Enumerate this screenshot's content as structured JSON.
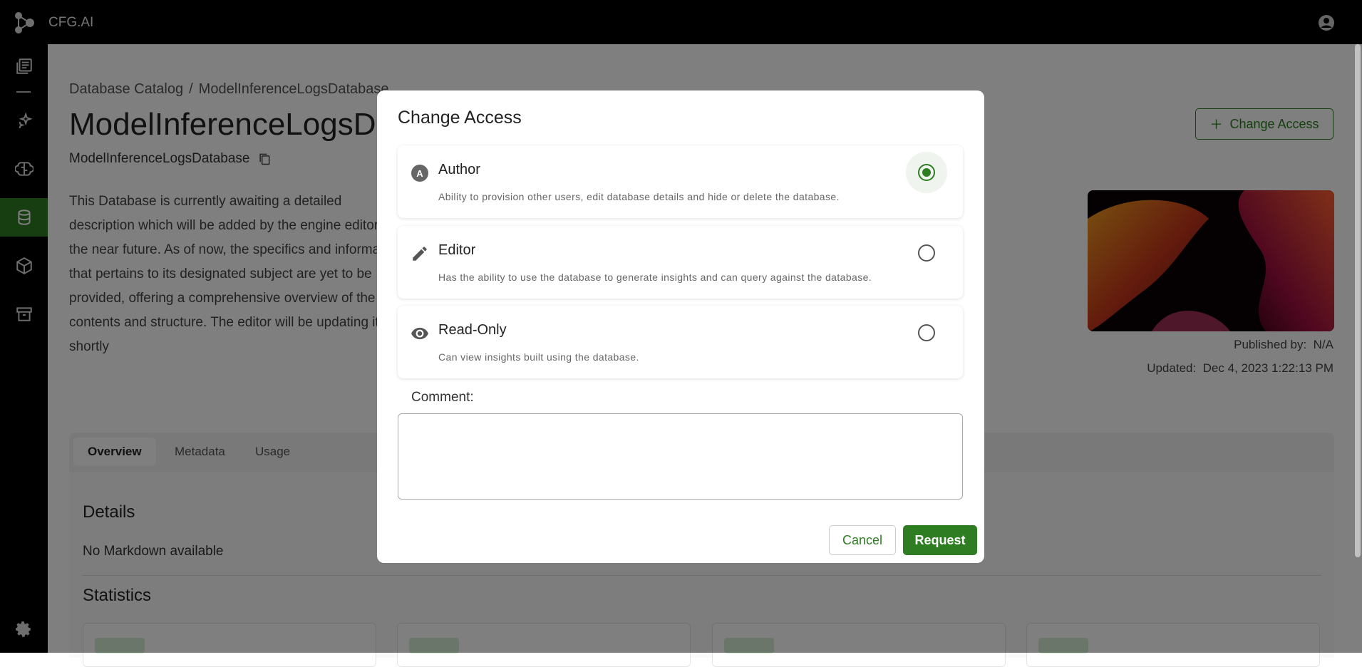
{
  "app": {
    "title": "CFG.AI"
  },
  "sidebar": {
    "items": [
      {
        "icon": "catalog-icon"
      },
      {
        "icon": "sparkle-icon"
      },
      {
        "icon": "brain-icon"
      },
      {
        "icon": "database-icon",
        "active": true
      },
      {
        "icon": "model-cube-icon"
      },
      {
        "icon": "archive-icon"
      }
    ],
    "footer_icon": "settings-icon"
  },
  "page": {
    "breadcrumb": [
      "Database Catalog",
      "ModelInferenceLogsDatabase"
    ],
    "breadcrumb_separator": "/",
    "title": "ModelInferenceLogsDatabase",
    "subtitle": "ModelInferenceLogsDatabase",
    "description": "This Database is currently awaiting a detailed description which will be added by the engine editor in the near future. As of now, the specifics and information that pertains to its designated subject are yet to be provided, offering a comprehensive overview of the contents and structure. The editor will be updating it shortly",
    "change_access_label": "Change Access",
    "published_label": "Published by:",
    "published_value": "N/A",
    "updated_label": "Updated:",
    "updated_value": "Dec 4, 2023 1:22:13 PM",
    "tabs": [
      "Overview",
      "Metadata",
      "Usage"
    ],
    "active_tab": "Overview",
    "details_heading": "Details",
    "no_markdown": "No Markdown available",
    "statistics_heading": "Statistics"
  },
  "modal": {
    "title": "Change Access",
    "options": [
      {
        "label": "Author",
        "description": "Ability to provision other users, edit database details and hide or delete the database.",
        "icon": "author-badge-icon",
        "selected": true
      },
      {
        "label": "Editor",
        "description": "Has the ability to use the database to generate insights and can query against the database.",
        "icon": "pencil-icon",
        "selected": false
      },
      {
        "label": "Read-Only",
        "description": "Can view insights built using the database.",
        "icon": "eye-icon",
        "selected": false
      }
    ],
    "comment_label": "Comment:",
    "comment_value": "",
    "cancel_label": "Cancel",
    "request_label": "Request"
  },
  "colors": {
    "accent": "#2e7d22",
    "topbar": "#000000"
  }
}
